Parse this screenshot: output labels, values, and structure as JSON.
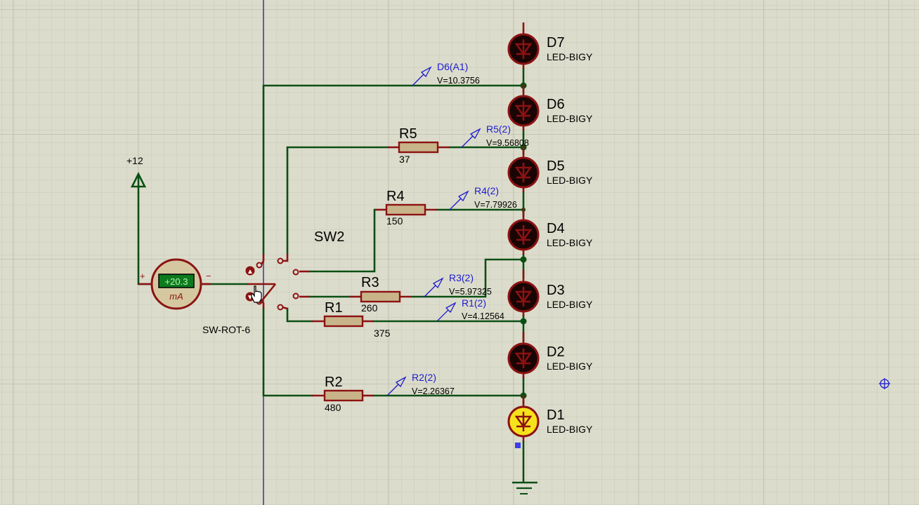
{
  "colors": {
    "background": "#dcdccc",
    "grid_minor": "#c9c9b9",
    "grid_major": "#b7b7a7",
    "wire": "#0a4f14",
    "component": "#8c1212",
    "probe": "#1c1cd0",
    "led_off": "#1a0505",
    "led_on": "#f6e21a",
    "meter_display": "#0d7a1e"
  },
  "power": {
    "label": "+12"
  },
  "ammeter": {
    "reading": "+20.3",
    "unit": "mA",
    "plus": "+",
    "minus": "−"
  },
  "switch": {
    "name": "SW2",
    "type": "SW-ROT-6"
  },
  "leds": [
    {
      "name": "D7",
      "type": "LED-BIGY",
      "lit": false
    },
    {
      "name": "D6",
      "type": "LED-BIGY",
      "lit": false
    },
    {
      "name": "D5",
      "type": "LED-BIGY",
      "lit": false
    },
    {
      "name": "D4",
      "type": "LED-BIGY",
      "lit": false
    },
    {
      "name": "D3",
      "type": "LED-BIGY",
      "lit": false
    },
    {
      "name": "D2",
      "type": "LED-BIGY",
      "lit": false
    },
    {
      "name": "D1",
      "type": "LED-BIGY",
      "lit": true
    }
  ],
  "resistors": [
    {
      "name": "R5",
      "value": "37"
    },
    {
      "name": "R4",
      "value": "150"
    },
    {
      "name": "R3",
      "value": "260"
    },
    {
      "name": "R1",
      "value": "375"
    },
    {
      "name": "R2",
      "value": "480"
    }
  ],
  "probes": [
    {
      "name": "D6(A1)",
      "voltage": "V=10.3756"
    },
    {
      "name": "R5(2)",
      "voltage": "V=9.56808"
    },
    {
      "name": "R4(2)",
      "voltage": "V=7.79926"
    },
    {
      "name": "R3(2)",
      "voltage": "V=5.97325"
    },
    {
      "name": "R1(2)",
      "voltage": "V=4.12564"
    },
    {
      "name": "R2(2)",
      "voltage": "V=2.26367"
    }
  ]
}
